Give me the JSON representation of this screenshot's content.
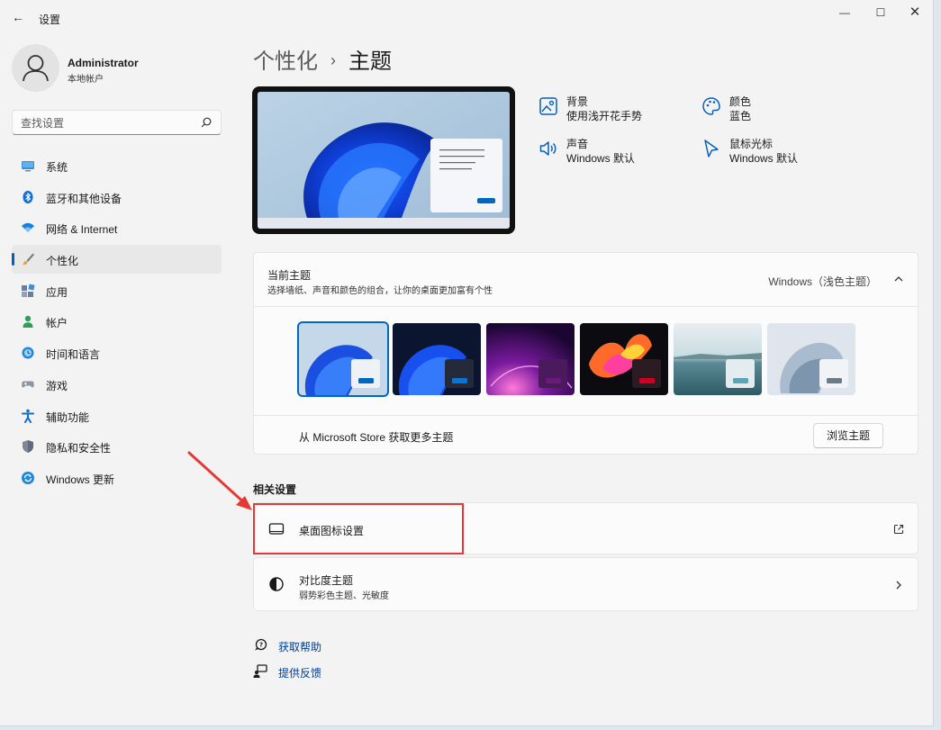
{
  "window": {
    "title": "设置",
    "minimize": "—",
    "maximize": "☐",
    "close": "✕",
    "back": "←"
  },
  "profile": {
    "name": "Administrator",
    "account_type": "本地帐户"
  },
  "search": {
    "placeholder": "查找设置"
  },
  "sidebar": {
    "items": [
      {
        "label": "系统",
        "icon": "monitor-icon"
      },
      {
        "label": "蓝牙和其他设备",
        "icon": "bluetooth-icon"
      },
      {
        "label": "网络 & Internet",
        "icon": "wifi-icon"
      },
      {
        "label": "个性化",
        "icon": "brush-icon",
        "active": true
      },
      {
        "label": "应用",
        "icon": "apps-icon"
      },
      {
        "label": "帐户",
        "icon": "person-icon"
      },
      {
        "label": "时间和语言",
        "icon": "clock-globe-icon"
      },
      {
        "label": "游戏",
        "icon": "gamepad-icon"
      },
      {
        "label": "辅助功能",
        "icon": "accessibility-icon"
      },
      {
        "label": "隐私和安全性",
        "icon": "shield-icon"
      },
      {
        "label": "Windows 更新",
        "icon": "update-icon"
      }
    ]
  },
  "breadcrumb": {
    "parent": "个性化",
    "separator": "›",
    "current": "主题"
  },
  "theme_props": {
    "background": {
      "title": "背景",
      "value": "使用浅开花手势"
    },
    "color": {
      "title": "颜色",
      "value": "蓝色"
    },
    "sound": {
      "title": "声音",
      "value": "Windows 默认"
    },
    "cursor": {
      "title": "鼠标光标",
      "value": "Windows 默认"
    }
  },
  "current_theme": {
    "title": "当前主题",
    "description": "选择墙纸、声音和颜色的组合，让你的桌面更加富有个性",
    "value": "Windows（浅色主题）",
    "themes": [
      {
        "name": "windows-light",
        "accent": "#0067c0",
        "selected": true
      },
      {
        "name": "windows-dark",
        "accent": "#0a74d4"
      },
      {
        "name": "glow",
        "accent": "#6a1b7a"
      },
      {
        "name": "captured-motion",
        "accent": "#d1001f"
      },
      {
        "name": "sunrise",
        "accent": "#5aa5b8"
      },
      {
        "name": "flow",
        "accent": "#6b7b8a"
      }
    ],
    "store_text": "从 Microsoft Store 获取更多主题",
    "browse_button": "浏览主题"
  },
  "related": {
    "heading": "相关设置",
    "desktop_icons": {
      "title": "桌面图标设置"
    },
    "contrast": {
      "title": "对比度主题",
      "subtitle": "弱势彩色主题、光敏度"
    }
  },
  "help": {
    "get_help": "获取帮助",
    "feedback": "提供反馈"
  },
  "colors": {
    "accent": "#0067c0",
    "annotation": "#e53935"
  }
}
